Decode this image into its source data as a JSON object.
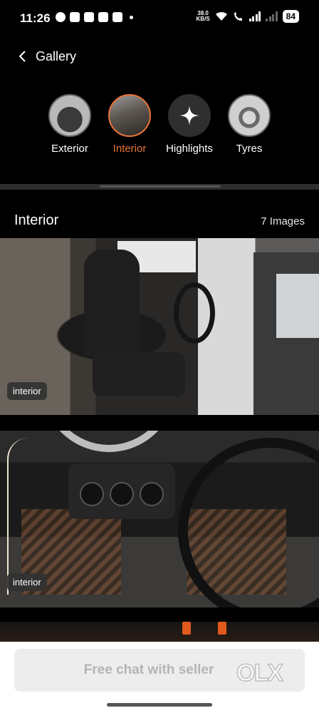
{
  "status_bar": {
    "time": "11:26",
    "net_speed_value": "38.0",
    "net_speed_unit": "KB/S",
    "battery": "84",
    "icons": [
      "whatsapp-icon",
      "grid-icon",
      "sim-card-icon",
      "plus-box-icon",
      "calendar-icon",
      "dot-icon",
      "wifi-icon",
      "volte-call-icon",
      "signal-icon",
      "signal-icon-2"
    ]
  },
  "header": {
    "title": "Gallery",
    "back_icon": "chevron-left-icon"
  },
  "categories": [
    {
      "label": "Exterior",
      "active": false
    },
    {
      "label": "Interior",
      "active": true
    },
    {
      "label": "Highlights",
      "active": false,
      "icon": "sparkle-icon"
    },
    {
      "label": "Tyres",
      "active": false
    }
  ],
  "section": {
    "title": "Interior",
    "count": "7 Images"
  },
  "photos": [
    {
      "tag": "interior"
    },
    {
      "tag": "interior"
    }
  ],
  "bottom": {
    "chat_button": "Free chat with seller",
    "brand": "OLX"
  },
  "colors": {
    "background": "#000000",
    "accent": "#e8743b",
    "button_bg": "#ededed",
    "button_text": "#b5b5b5"
  }
}
